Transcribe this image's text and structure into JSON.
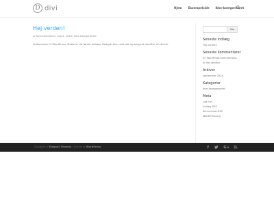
{
  "header": {
    "logo_letter": "D",
    "logo_text": "divi",
    "nav": [
      "Hjem",
      "Eksempelside",
      "Ikke-kategoriseret"
    ],
    "search_icon": "search-icon"
  },
  "post": {
    "title": "Hej verden!",
    "meta": "af fanecrenbetem | sep 4, 2018 | Ikke-kategoriseret",
    "text": "Velkommen til WordPress. Dette er dit første indlæg. Redigér eller slet det og begynd derefter at skrive!"
  },
  "sidebar": {
    "search_button": "Søg",
    "recent_posts_title": "Seneste indlæg",
    "recent_posts": [
      "Hej verden!"
    ],
    "recent_comments_title": "Seneste kommentarer",
    "recent_comments": [
      "En WordPress-kommentator",
      "til Hej verden!"
    ],
    "archives_title": "Arkiver",
    "archives": [
      "september 2018"
    ],
    "categories_title": "Kategorier",
    "categories": [
      "Ikke-kategoriseret"
    ],
    "meta_title": "Meta",
    "meta_links": [
      "Log ind",
      "Indlæg-RSS",
      "Kommentar-RSS",
      "WordPress.org"
    ]
  },
  "footer": {
    "designed_by": "Designet af",
    "theme_author": "Elegant Themes",
    "powered_by": "| Drevet af",
    "platform": "WordPress",
    "social_icons": [
      "facebook-icon",
      "twitter-icon",
      "google-plus-icon",
      "rss-icon"
    ]
  },
  "colors": {
    "accent": "#2ea3f2",
    "footer_bg": "#222222"
  }
}
